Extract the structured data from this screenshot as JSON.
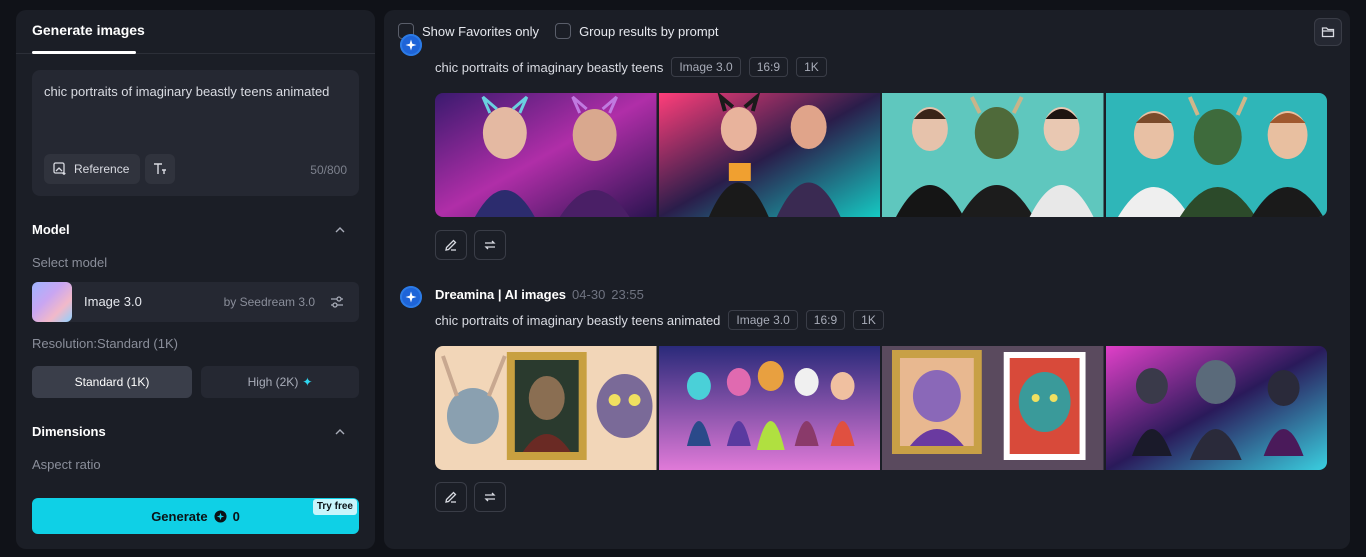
{
  "left_panel": {
    "tab_label": "Generate images",
    "prompt_text": "chic portraits of imaginary beastly teens animated",
    "reference_label": "Reference",
    "char_count": "50/800",
    "model": {
      "section_title": "Model",
      "select_label": "Select model",
      "name": "Image 3.0",
      "by": "by Seedream 3.0"
    },
    "resolution": {
      "label": "Resolution:Standard (1K)",
      "standard": "Standard (1K)",
      "high": "High (2K)"
    },
    "dimensions": {
      "section_title": "Dimensions",
      "aspect_label": "Aspect ratio"
    },
    "generate": {
      "label": "Generate",
      "credits": "0",
      "badge": "Try free"
    }
  },
  "right_panel": {
    "filters": [
      "Show Favorites only",
      "Group results by prompt"
    ],
    "groups": [
      {
        "author": "",
        "date": "",
        "time": "",
        "prompt": "chic portraits of imaginary beastly teens",
        "tags": [
          "Image 3.0",
          "16:9",
          "1K"
        ]
      },
      {
        "author": "Dreamina | AI images",
        "date": "04-30",
        "time": "23:55",
        "prompt": "chic portraits of imaginary beastly teens animated",
        "tags": [
          "Image 3.0",
          "16:9",
          "1K"
        ]
      }
    ]
  },
  "colors": {
    "accent": "#0fd0e6",
    "panel": "#1b1e26",
    "background": "#101218"
  },
  "icons": [
    "image-add-icon",
    "text-format-icon",
    "chevron-up-icon",
    "settings-sliders-icon",
    "sparkle-icon",
    "credit-icon",
    "folder-icon",
    "dreamina-star-icon",
    "edit-pencil-icon",
    "regenerate-icon"
  ]
}
